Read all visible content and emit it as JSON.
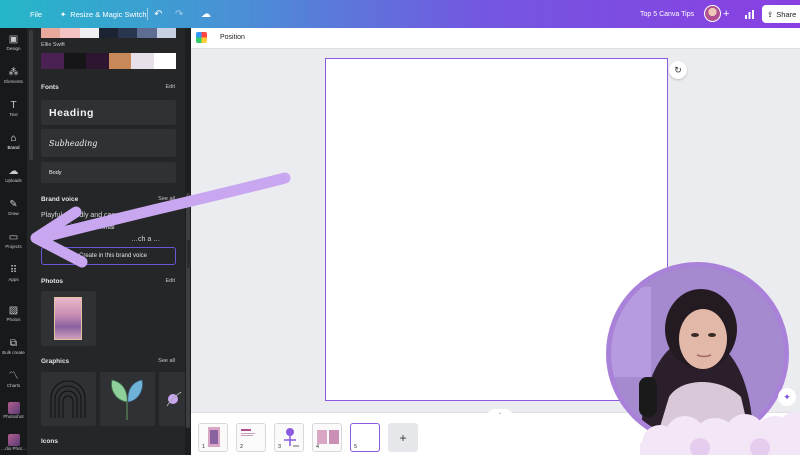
{
  "topbar": {
    "file_label": "File",
    "resize_label": "Resize & Magic Switch",
    "doc_title": "Top 5 Canva Tips",
    "share_label": "Share"
  },
  "rail": {
    "items": [
      {
        "label": "Design",
        "icon": "design-icon"
      },
      {
        "label": "Elements",
        "icon": "elements-icon"
      },
      {
        "label": "Text",
        "icon": "text-icon"
      },
      {
        "label": "Brand",
        "icon": "brand-icon"
      },
      {
        "label": "Uploads",
        "icon": "uploads-icon"
      },
      {
        "label": "Draw",
        "icon": "draw-icon"
      },
      {
        "label": "Projects",
        "icon": "projects-icon"
      },
      {
        "label": "Apps",
        "icon": "apps-icon"
      },
      {
        "label": "Photos",
        "icon": "photos-icon"
      },
      {
        "label": "Bulk create",
        "icon": "bulk-create-icon"
      },
      {
        "label": "Charts",
        "icon": "charts-icon"
      },
      {
        "label": "Photoshot",
        "icon": "photoshot-icon"
      },
      {
        "label": "…dio Phot…",
        "icon": "studio-photo-icon"
      }
    ]
  },
  "panel": {
    "brand_kit_name": "Ellie Swift",
    "palette_top": [
      "#e8a89c",
      "#f4c4c4",
      "#f0f0f2",
      "#1c2433",
      "#2a3550",
      "#5e6d91",
      "#c8d0e4"
    ],
    "palette": [
      "#4a2152",
      "#161618",
      "#2e1530",
      "#c88858",
      "#e8e0e8",
      "#ffffff"
    ],
    "fonts_heading": "Fonts",
    "fonts_edit": "Edit",
    "font_heading_sample": "Heading",
    "font_subheading_sample": "Subheading",
    "font_body_sample": "Body",
    "voice_heading": "Brand voice",
    "voice_see_all": "See all",
    "voice_text_1": "Playful, friendly and casual",
    "voice_text_2": "…ation with a millennial",
    "voice_text_3": "…ch a …",
    "voice_button": "Create in this brand voice",
    "photos_heading": "Photos",
    "photos_edit": "Edit",
    "graphics_heading": "Graphics",
    "graphics_see_all": "See all",
    "icons_heading": "Icons"
  },
  "context_bar": {
    "position_label": "Position"
  },
  "pages": [
    "1",
    "2",
    "3",
    "4",
    "5"
  ],
  "colors": {
    "accent": "#8a5ae0",
    "panel_bg": "#252627",
    "rail_bg": "#18191b",
    "arrow": "#c9a6f0"
  }
}
